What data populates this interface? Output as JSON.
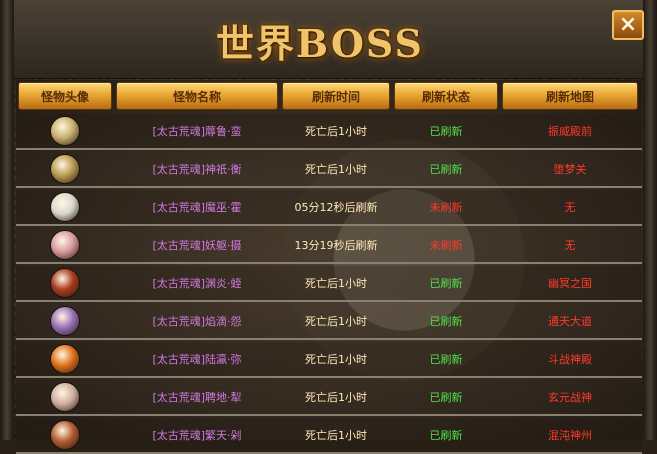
{
  "title": "世界BOSS",
  "close_label": "×",
  "columns": [
    "怪物头像",
    "怪物名称",
    "刷新时间",
    "刷新状态",
    "刷新地图"
  ],
  "rows": [
    {
      "name": "[太古荒魂]蓐鲁·蛮",
      "time": "死亡后1小时",
      "status": "已刷新",
      "status_type": "done",
      "map": "振威殿前",
      "avatar_color": "#c8b070",
      "avatar_icon": "horned-demon-avatar"
    },
    {
      "name": "[太古荒魂]神祇·衡",
      "time": "死亡后1小时",
      "status": "已刷新",
      "status_type": "done",
      "map": "堕梦关",
      "avatar_color": "#b89a50",
      "avatar_icon": "armored-warrior-avatar"
    },
    {
      "name": "[太古荒魂]魔巫·霍",
      "time": "05分12秒后刷新",
      "status": "未刷新",
      "status_type": "pending",
      "map": "无",
      "avatar_color": "#d8d8d0",
      "avatar_icon": "pale-beast-avatar"
    },
    {
      "name": "[太古荒魂]妖躯·摄",
      "time": "13分19秒后刷新",
      "status": "未刷新",
      "status_type": "pending",
      "map": "无",
      "avatar_color": "#d89aa0",
      "avatar_icon": "pink-demon-avatar"
    },
    {
      "name": "[太古荒魂]渊炎·蛭",
      "time": "死亡后1小时",
      "status": "已刷新",
      "status_type": "done",
      "map": "幽冥之国",
      "avatar_color": "#a83a20",
      "avatar_icon": "fire-demon-avatar"
    },
    {
      "name": "[太古荒魂]焰滴·怨",
      "time": "死亡后1小时",
      "status": "已刷新",
      "status_type": "done",
      "map": "通天大道",
      "avatar_color": "#9a70b8",
      "avatar_icon": "violet-wraith-avatar"
    },
    {
      "name": "[太古荒魂]陆瀛·弥",
      "time": "死亡后1小时",
      "status": "已刷新",
      "status_type": "done",
      "map": "斗战神殿",
      "avatar_color": "#e0701a",
      "avatar_icon": "flame-beast-avatar"
    },
    {
      "name": "[太古荒魂]聘地·犁",
      "time": "死亡后1小时",
      "status": "已刷新",
      "status_type": "done",
      "map": "玄元战神",
      "avatar_color": "#d0b0a0",
      "avatar_icon": "stone-giant-avatar"
    },
    {
      "name": "[太古荒魂]繁天·剁",
      "time": "死亡后1小时",
      "status": "已刷新",
      "status_type": "done",
      "map": "混沌神州",
      "avatar_color": "#b05a30",
      "avatar_icon": "bronze-demon-avatar"
    }
  ]
}
